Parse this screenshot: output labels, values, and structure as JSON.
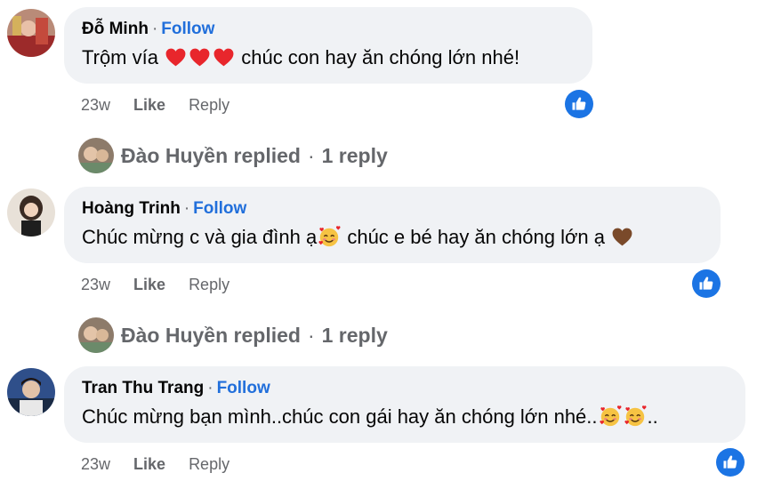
{
  "comments": [
    {
      "author": "Đỗ Minh",
      "separator": "·",
      "follow": "Follow",
      "text_before": "Trộm vía",
      "text_after": " chúc con hay ăn chóng lớn nhé!",
      "emoji": [
        "red-heart",
        "red-heart",
        "red-heart"
      ],
      "time": "23w",
      "like_label": "Like",
      "reply_label": "Reply",
      "reaction_icon": "thumbs-up-icon",
      "reply_summary": {
        "name": "Đào Huyền replied",
        "separator": "·",
        "count": "1 reply"
      }
    },
    {
      "author": "Hoàng Trinh",
      "separator": "·",
      "follow": "Follow",
      "text_before": "Chúc mừng c và gia đình ạ",
      "text_middle": " chúc e bé hay ăn chóng lớn ạ ",
      "emoji": [
        "smiling-face-with-hearts",
        "brown-heart"
      ],
      "time": "23w",
      "like_label": "Like",
      "reply_label": "Reply",
      "reaction_icon": "thumbs-up-icon",
      "reply_summary": {
        "name": "Đào Huyền replied",
        "separator": "·",
        "count": "1 reply"
      }
    },
    {
      "author": "Tran Thu Trang",
      "separator": "·",
      "follow": "Follow",
      "text_before": "Chúc mừng bạn mình..chúc con gái hay ăn chóng lớn nhé..",
      "text_after": "..",
      "emoji": [
        "smiling-face-with-hearts",
        "smiling-face-with-hearts"
      ],
      "time": "23w",
      "like_label": "Like",
      "reply_label": "Reply",
      "reaction_icon": "thumbs-up-icon"
    }
  ],
  "colors": {
    "accent": "#216fdb",
    "bubble": "#f0f2f5",
    "meta": "#65676b",
    "like_badge": "#1b74e4"
  }
}
